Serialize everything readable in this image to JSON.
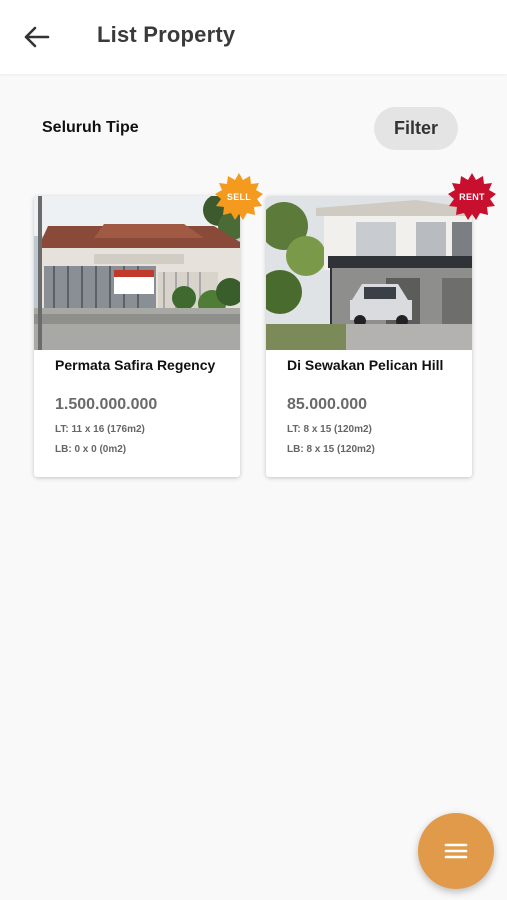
{
  "appbar": {
    "title": "List Property",
    "back_icon": "arrow-left-icon"
  },
  "filter_bar": {
    "type_label": "Seluruh Tipe",
    "filter_button": "Filter"
  },
  "properties": [
    {
      "badge": "SELL",
      "badge_color": "#f39a1f",
      "name": "Permata Safira Regency",
      "price": "1.500.000.000",
      "lt": "LT: 11 x 16 (176m2)",
      "lb": "LB: 0 x 0 (0m2)"
    },
    {
      "badge": "RENT",
      "badge_color": "#c8102e",
      "name": "Di Sewakan Pelican Hill",
      "price": "85.000.000",
      "lt": "LT: 8 x 15 (120m2)",
      "lb": "LB: 8 x 15 (120m2)"
    }
  ],
  "fab": {
    "icon": "menu-icon",
    "color": "#e09a4a"
  }
}
